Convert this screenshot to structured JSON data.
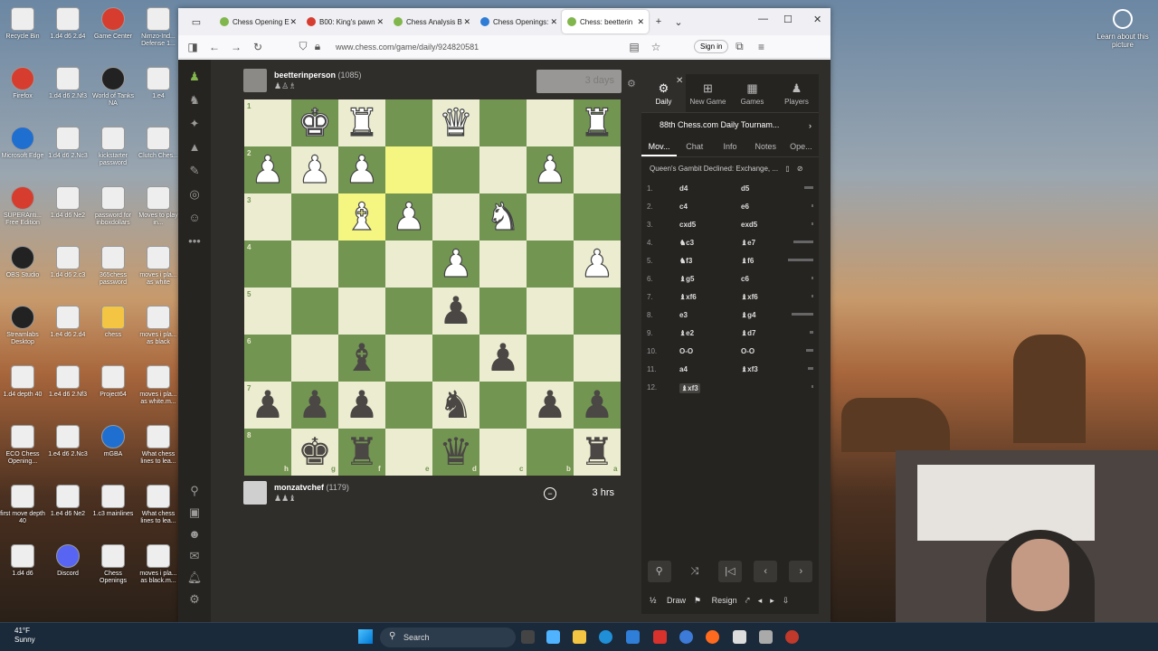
{
  "desktop_icons": [
    {
      "label": "Recycle Bin",
      "kind": "bin"
    },
    {
      "label": "1.d4 d6 2.d4",
      "kind": "file"
    },
    {
      "label": "Game Center",
      "kind": "red"
    },
    {
      "label": "Nimzo-Ind... Defense 1...",
      "kind": "file"
    },
    {
      "label": "Firefox",
      "kind": "red"
    },
    {
      "label": "1.d4 d6 2.Nf3",
      "kind": "file"
    },
    {
      "label": "World of Tanks NA",
      "kind": "dark"
    },
    {
      "label": "1.e4",
      "kind": "file"
    },
    {
      "label": "Microsoft Edge",
      "kind": "blue"
    },
    {
      "label": "1.d4 d6 2.Nc3",
      "kind": "file"
    },
    {
      "label": "kickstarter password",
      "kind": "file"
    },
    {
      "label": "Clutch Ches...",
      "kind": "file"
    },
    {
      "label": "SUPERAnti... Free Edition",
      "kind": "red"
    },
    {
      "label": "1.d4 d6 Ne2",
      "kind": "file"
    },
    {
      "label": "password for inboxdollars",
      "kind": "file"
    },
    {
      "label": "Moves to play in...",
      "kind": "file"
    },
    {
      "label": "OBS Studio",
      "kind": "dark"
    },
    {
      "label": "1.d4 d6 2.c3",
      "kind": "file"
    },
    {
      "label": "365chess password",
      "kind": "file"
    },
    {
      "label": "moves i pla... as white",
      "kind": "file"
    },
    {
      "label": "Streamlabs Desktop",
      "kind": "dark"
    },
    {
      "label": "1.e4 d6 2.d4",
      "kind": "file"
    },
    {
      "label": "chess",
      "kind": "fold"
    },
    {
      "label": "moves i pla... as black",
      "kind": "file"
    },
    {
      "label": "1.d4 depth 40",
      "kind": "file"
    },
    {
      "label": "1.e4 d6 2.Nf3",
      "kind": "file"
    },
    {
      "label": "Project64",
      "kind": "file"
    },
    {
      "label": "moves i pla... as white.m...",
      "kind": "file"
    },
    {
      "label": "ECO Chess Opening...",
      "kind": "file"
    },
    {
      "label": "1.e4 d6 2.Nc3",
      "kind": "file"
    },
    {
      "label": "mGBA",
      "kind": "blue"
    },
    {
      "label": "What chess lines to lea...",
      "kind": "file"
    },
    {
      "label": "first move depth 40",
      "kind": "file"
    },
    {
      "label": "1.e4 d6 Ne2",
      "kind": "file"
    },
    {
      "label": "1.c3 mainlines",
      "kind": "file"
    },
    {
      "label": "What chess lines to lea...",
      "kind": "file"
    },
    {
      "label": "1.d4 d6",
      "kind": "file"
    },
    {
      "label": "Discord",
      "kind": "disc"
    },
    {
      "label": "Chess Openings",
      "kind": "file"
    },
    {
      "label": "moves i pla... as black.m...",
      "kind": "file"
    }
  ],
  "about_picture": "Learn about this picture",
  "browser": {
    "tabs": [
      {
        "label": "Chess Opening E",
        "icon": "pawn-favicon",
        "color": "#81b64c"
      },
      {
        "label": "B00: King's pawn",
        "icon": "book-favicon",
        "color": "#d63d2f"
      },
      {
        "label": "Chess Analysis B",
        "icon": "pawn-favicon",
        "color": "#81b64c"
      },
      {
        "label": "Chess Openings:",
        "icon": "globe-favicon",
        "color": "#2e7cd6"
      },
      {
        "label": "Chess: beetterin",
        "icon": "pawn-favicon",
        "color": "#81b64c"
      }
    ],
    "url": "www.chess.com/game/daily/924820581",
    "sign_in": "Sign in"
  },
  "game": {
    "top_player": {
      "name": "beetterinperson",
      "rating": "(1085)",
      "captures": "♟♙♗",
      "clock": "3 days"
    },
    "bottom_player": {
      "name": "monzatvchef",
      "rating": "(1179)",
      "captures": "♟♟♝",
      "clock": "3 hrs"
    },
    "rank_labels": [
      "1",
      "2",
      "3",
      "4",
      "5",
      "6",
      "7",
      "8"
    ],
    "file_labels": [
      "h",
      "g",
      "f",
      "e",
      "d",
      "c",
      "b",
      "a"
    ],
    "pieces": [
      {
        "row": 0,
        "col": 1,
        "glyph": "♚",
        "color": "white"
      },
      {
        "row": 0,
        "col": 2,
        "glyph": "♜",
        "color": "white"
      },
      {
        "row": 0,
        "col": 4,
        "glyph": "♛",
        "color": "white"
      },
      {
        "row": 0,
        "col": 7,
        "glyph": "♜",
        "color": "white"
      },
      {
        "row": 1,
        "col": 0,
        "glyph": "♟",
        "color": "white"
      },
      {
        "row": 1,
        "col": 1,
        "glyph": "♟",
        "color": "white"
      },
      {
        "row": 1,
        "col": 2,
        "glyph": "♟",
        "color": "white"
      },
      {
        "row": 1,
        "col": 6,
        "glyph": "♟",
        "color": "white"
      },
      {
        "row": 2,
        "col": 2,
        "glyph": "♝",
        "color": "white"
      },
      {
        "row": 2,
        "col": 3,
        "glyph": "♟",
        "color": "white"
      },
      {
        "row": 2,
        "col": 5,
        "glyph": "♞",
        "color": "white"
      },
      {
        "row": 3,
        "col": 4,
        "glyph": "♟",
        "color": "white"
      },
      {
        "row": 3,
        "col": 7,
        "glyph": "♟",
        "color": "white"
      },
      {
        "row": 4,
        "col": 4,
        "glyph": "♟",
        "color": "black"
      },
      {
        "row": 5,
        "col": 2,
        "glyph": "♝",
        "color": "black"
      },
      {
        "row": 5,
        "col": 5,
        "glyph": "♟",
        "color": "black"
      },
      {
        "row": 6,
        "col": 0,
        "glyph": "♟",
        "color": "black"
      },
      {
        "row": 6,
        "col": 1,
        "glyph": "♟",
        "color": "black"
      },
      {
        "row": 6,
        "col": 2,
        "glyph": "♟",
        "color": "black"
      },
      {
        "row": 6,
        "col": 4,
        "glyph": "♞",
        "color": "black"
      },
      {
        "row": 6,
        "col": 6,
        "glyph": "♟",
        "color": "black"
      },
      {
        "row": 6,
        "col": 7,
        "glyph": "♟",
        "color": "black"
      },
      {
        "row": 7,
        "col": 1,
        "glyph": "♚",
        "color": "black"
      },
      {
        "row": 7,
        "col": 2,
        "glyph": "♜",
        "color": "black"
      },
      {
        "row": 7,
        "col": 4,
        "glyph": "♛",
        "color": "black"
      },
      {
        "row": 7,
        "col": 7,
        "glyph": "♜",
        "color": "black"
      }
    ],
    "highlights": [
      {
        "row": 1,
        "col": 3
      },
      {
        "row": 2,
        "col": 2
      }
    ]
  },
  "panel": {
    "tabs": [
      {
        "label": "Daily",
        "icon": "gear-icon"
      },
      {
        "label": "New Game",
        "icon": "plus-icon"
      },
      {
        "label": "Games",
        "icon": "grid-icon"
      },
      {
        "label": "Players",
        "icon": "players-icon"
      }
    ],
    "tournament": "88th Chess.com Daily Tournam...",
    "subtabs": [
      "Mov...",
      "Chat",
      "Info",
      "Notes",
      "Ope..."
    ],
    "opening": "Queen's Gambit Declined: Exchange, ...",
    "moves": [
      {
        "n": "1.",
        "w": "d4",
        "b": "d5"
      },
      {
        "n": "2.",
        "w": "c4",
        "b": "e6"
      },
      {
        "n": "3.",
        "w": "cxd5",
        "b": "exd5"
      },
      {
        "n": "4.",
        "w": "♞c3",
        "b": "♝e7"
      },
      {
        "n": "5.",
        "w": "♞f3",
        "b": "♝f6"
      },
      {
        "n": "6.",
        "w": "♝g5",
        "b": "c6"
      },
      {
        "n": "7.",
        "w": "♝xf6",
        "b": "♝xf6"
      },
      {
        "n": "8.",
        "w": "e3",
        "b": "♝g4"
      },
      {
        "n": "9.",
        "w": "♝e2",
        "b": "♝d7"
      },
      {
        "n": "10.",
        "w": "O-O",
        "b": "O-O"
      },
      {
        "n": "11.",
        "w": "a4",
        "b": "♝xf3"
      },
      {
        "n": "12.",
        "w": "♝xf3",
        "b": ""
      }
    ],
    "draw": "Draw",
    "resign": "Resign"
  },
  "taskbar": {
    "temp": "41°F",
    "weather": "Sunny",
    "search": "Search"
  }
}
